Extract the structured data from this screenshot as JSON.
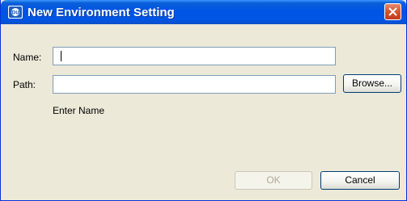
{
  "window": {
    "title": "New Environment Setting"
  },
  "form": {
    "name_label": "Name:",
    "name_value": "",
    "path_label": "Path:",
    "path_value": "",
    "browse_label": "Browse...",
    "hint": "Enter Name"
  },
  "buttons": {
    "ok_label": "OK",
    "ok_enabled": false,
    "cancel_label": "Cancel"
  },
  "colors": {
    "titlebar": "#0054e3",
    "dialog_background": "#ece9d8",
    "close_button": "#d4552e",
    "input_border": "#7f9db9"
  },
  "icons": {
    "app": "app-logo-icon",
    "close": "close-icon"
  }
}
